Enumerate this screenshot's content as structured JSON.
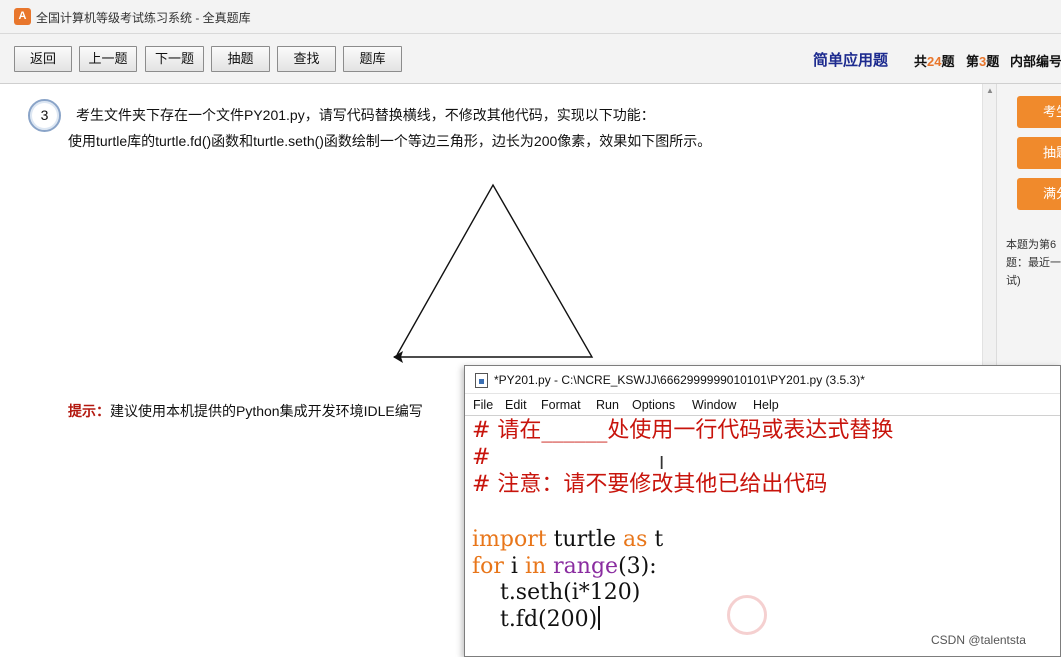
{
  "window": {
    "icon_label": "A",
    "title": "全国计算机等级考试练习系统 - 全真题库"
  },
  "toolbar": {
    "buttons": [
      "返回",
      "上一题",
      "下一题",
      "抽题",
      "查找",
      "题库"
    ],
    "question_type": "简单应用题",
    "total_prefix": "共",
    "total_count": "24",
    "total_suffix": "题",
    "current_prefix": "第",
    "current_index": "3",
    "current_suffix": "题",
    "internal_id_label": "内部编号"
  },
  "question": {
    "number": "3",
    "line1": "考生文件夹下存在一个文件PY201.py，请写代码替换横线，不修改其他代码，实现以下功能：",
    "line2": "使用turtle库的turtle.fd()函数和turtle.seth()函数绘制一个等边三角形，边长为200像素，效果如下图所示。",
    "hint_label": "提示：",
    "hint_text": "建议使用本机提供的Python集成开发环境IDLE编写"
  },
  "figure": {
    "shape": "equilateral-triangle",
    "side_length": 200,
    "turtle_cursor": "arrow"
  },
  "right_panel": {
    "buttons": [
      "考生",
      "抽题",
      "满分"
    ],
    "info": "本题为第6题：最近一试)"
  },
  "idle": {
    "title": "*PY201.py - C:\\NCRE_KSWJJ\\6662999999010101\\PY201.py (3.5.3)*",
    "menu": [
      "File",
      "Edit",
      "Format",
      "Run",
      "Options",
      "Window",
      "Help"
    ],
    "comment1": "# 请在______处使用一行代码或表达式替换",
    "comment2": "#",
    "comment3": "# 注意：请不要修改其他已给出代码",
    "code_import_kw": "import",
    "code_import_mod": " turtle ",
    "code_as_kw": "as",
    "code_alias": " t",
    "code_for_kw": "for",
    "code_var": " i ",
    "code_in_kw": "in",
    "code_space": " ",
    "code_range": "range",
    "code_range_args": "(3):",
    "code_seth": "    t.seth(i*120)",
    "code_fd": "    t.fd(200)"
  },
  "colors": {
    "accent_orange": "#f08a2c",
    "title_blue": "#1d2b8f",
    "hint_red": "#b3180f",
    "comment_red": "#c8140c",
    "keyword_orange": "#e8761a",
    "builtin_purple": "#8a2ca0"
  },
  "watermark": "CSDN @talentsta"
}
